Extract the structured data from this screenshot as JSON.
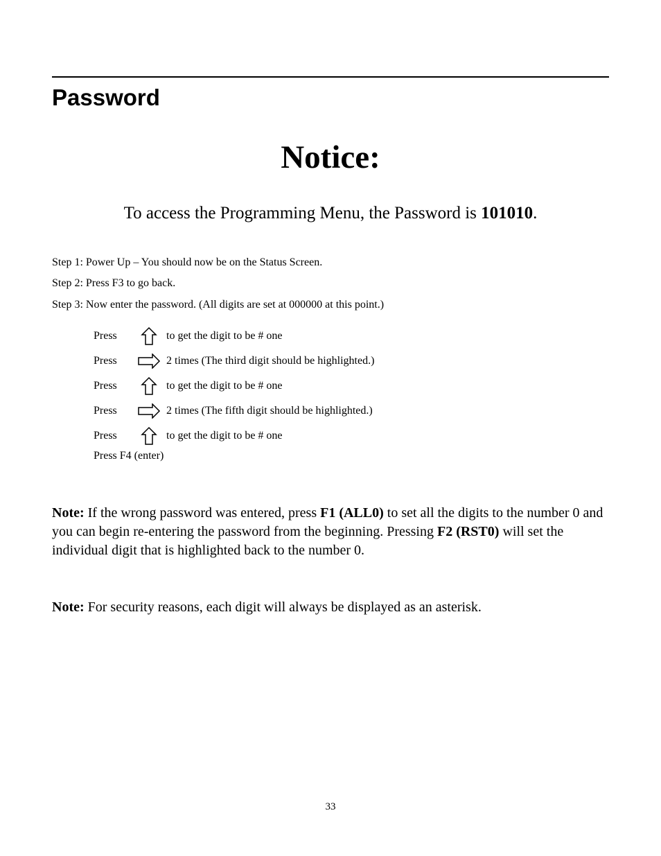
{
  "section_heading": "Password",
  "notice_heading": "Notice:",
  "access_line_prefix": "To access the Programming Menu, the Password is ",
  "access_line_password": "101010",
  "access_line_suffix": ".",
  "steps": {
    "s1": "Step 1: Power Up – You should now be on the Status Screen.",
    "s2": "Step 2: Press F3 to go back.",
    "s3": "Step 3: Now enter the password. (All digits are set at 000000 at this point.)"
  },
  "press_rows": [
    {
      "label": "Press",
      "icon": "up",
      "desc": "to get the digit to be # one"
    },
    {
      "label": "Press",
      "icon": "right",
      "desc": "2 times (The third digit should be highlighted.)"
    },
    {
      "label": "Press",
      "icon": "up",
      "desc": "to get the digit to be # one"
    },
    {
      "label": "Press",
      "icon": "right",
      "desc": "2 times (The fifth digit should be highlighted.)"
    },
    {
      "label": "Press",
      "icon": "up",
      "desc": "to get the digit to be # one"
    }
  ],
  "press_final": "Press F4 (enter)",
  "note1": {
    "bold_lead": "Note:",
    "t1": " If the wrong password was entered, press ",
    "b1": "F1 (ALL0)",
    "t2": " to set all the digits to the number 0 and you can begin re-entering the password from the beginning.  Pressing ",
    "b2": "F2 (RST0)",
    "t3": " will set the individual digit that is highlighted back to the number 0."
  },
  "note2": {
    "bold_lead": "Note:",
    "text": " For security reasons, each digit will always be displayed as an asterisk."
  },
  "page_number": "33"
}
